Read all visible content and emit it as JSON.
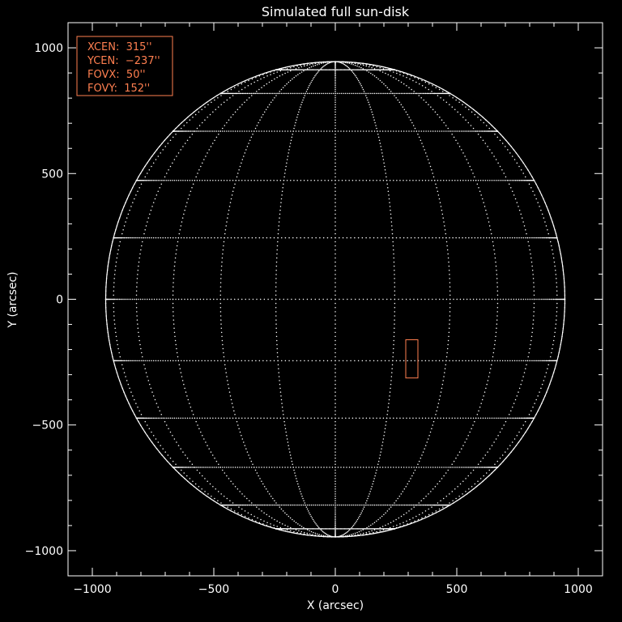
{
  "colors": {
    "background": "#000000",
    "foreground": "#ffffff",
    "accent": "#ff7f50"
  },
  "chart_data": {
    "type": "scatter",
    "title": "Simulated full sun-disk",
    "xlabel": "X (arcsec)",
    "ylabel": "Y (arcsec)",
    "xlim": [
      -1100,
      1100
    ],
    "ylim": [
      -1100,
      1100
    ],
    "xticks": [
      -1000,
      -500,
      0,
      500,
      1000
    ],
    "yticks": [
      -1000,
      -500,
      0,
      500,
      1000
    ],
    "xtick_labels": [
      "−1000",
      "−500",
      "0",
      "500",
      "1000"
    ],
    "ytick_labels": [
      "−1000",
      "−500",
      "0",
      "500",
      "1000"
    ],
    "solar_radius_arcsec": 945,
    "grid": "dotted heliographic latitude/longitude grid, 15 degree spacing",
    "field_of_view": {
      "xcen": 315,
      "ycen": -237,
      "fovx": 50,
      "fovy": 152
    },
    "legend": {
      "position": "top-left",
      "lines": [
        "XCEN:  315''",
        "YCEN:  −237''",
        "FOVX:  50''",
        "FOVY:  152''"
      ]
    }
  }
}
